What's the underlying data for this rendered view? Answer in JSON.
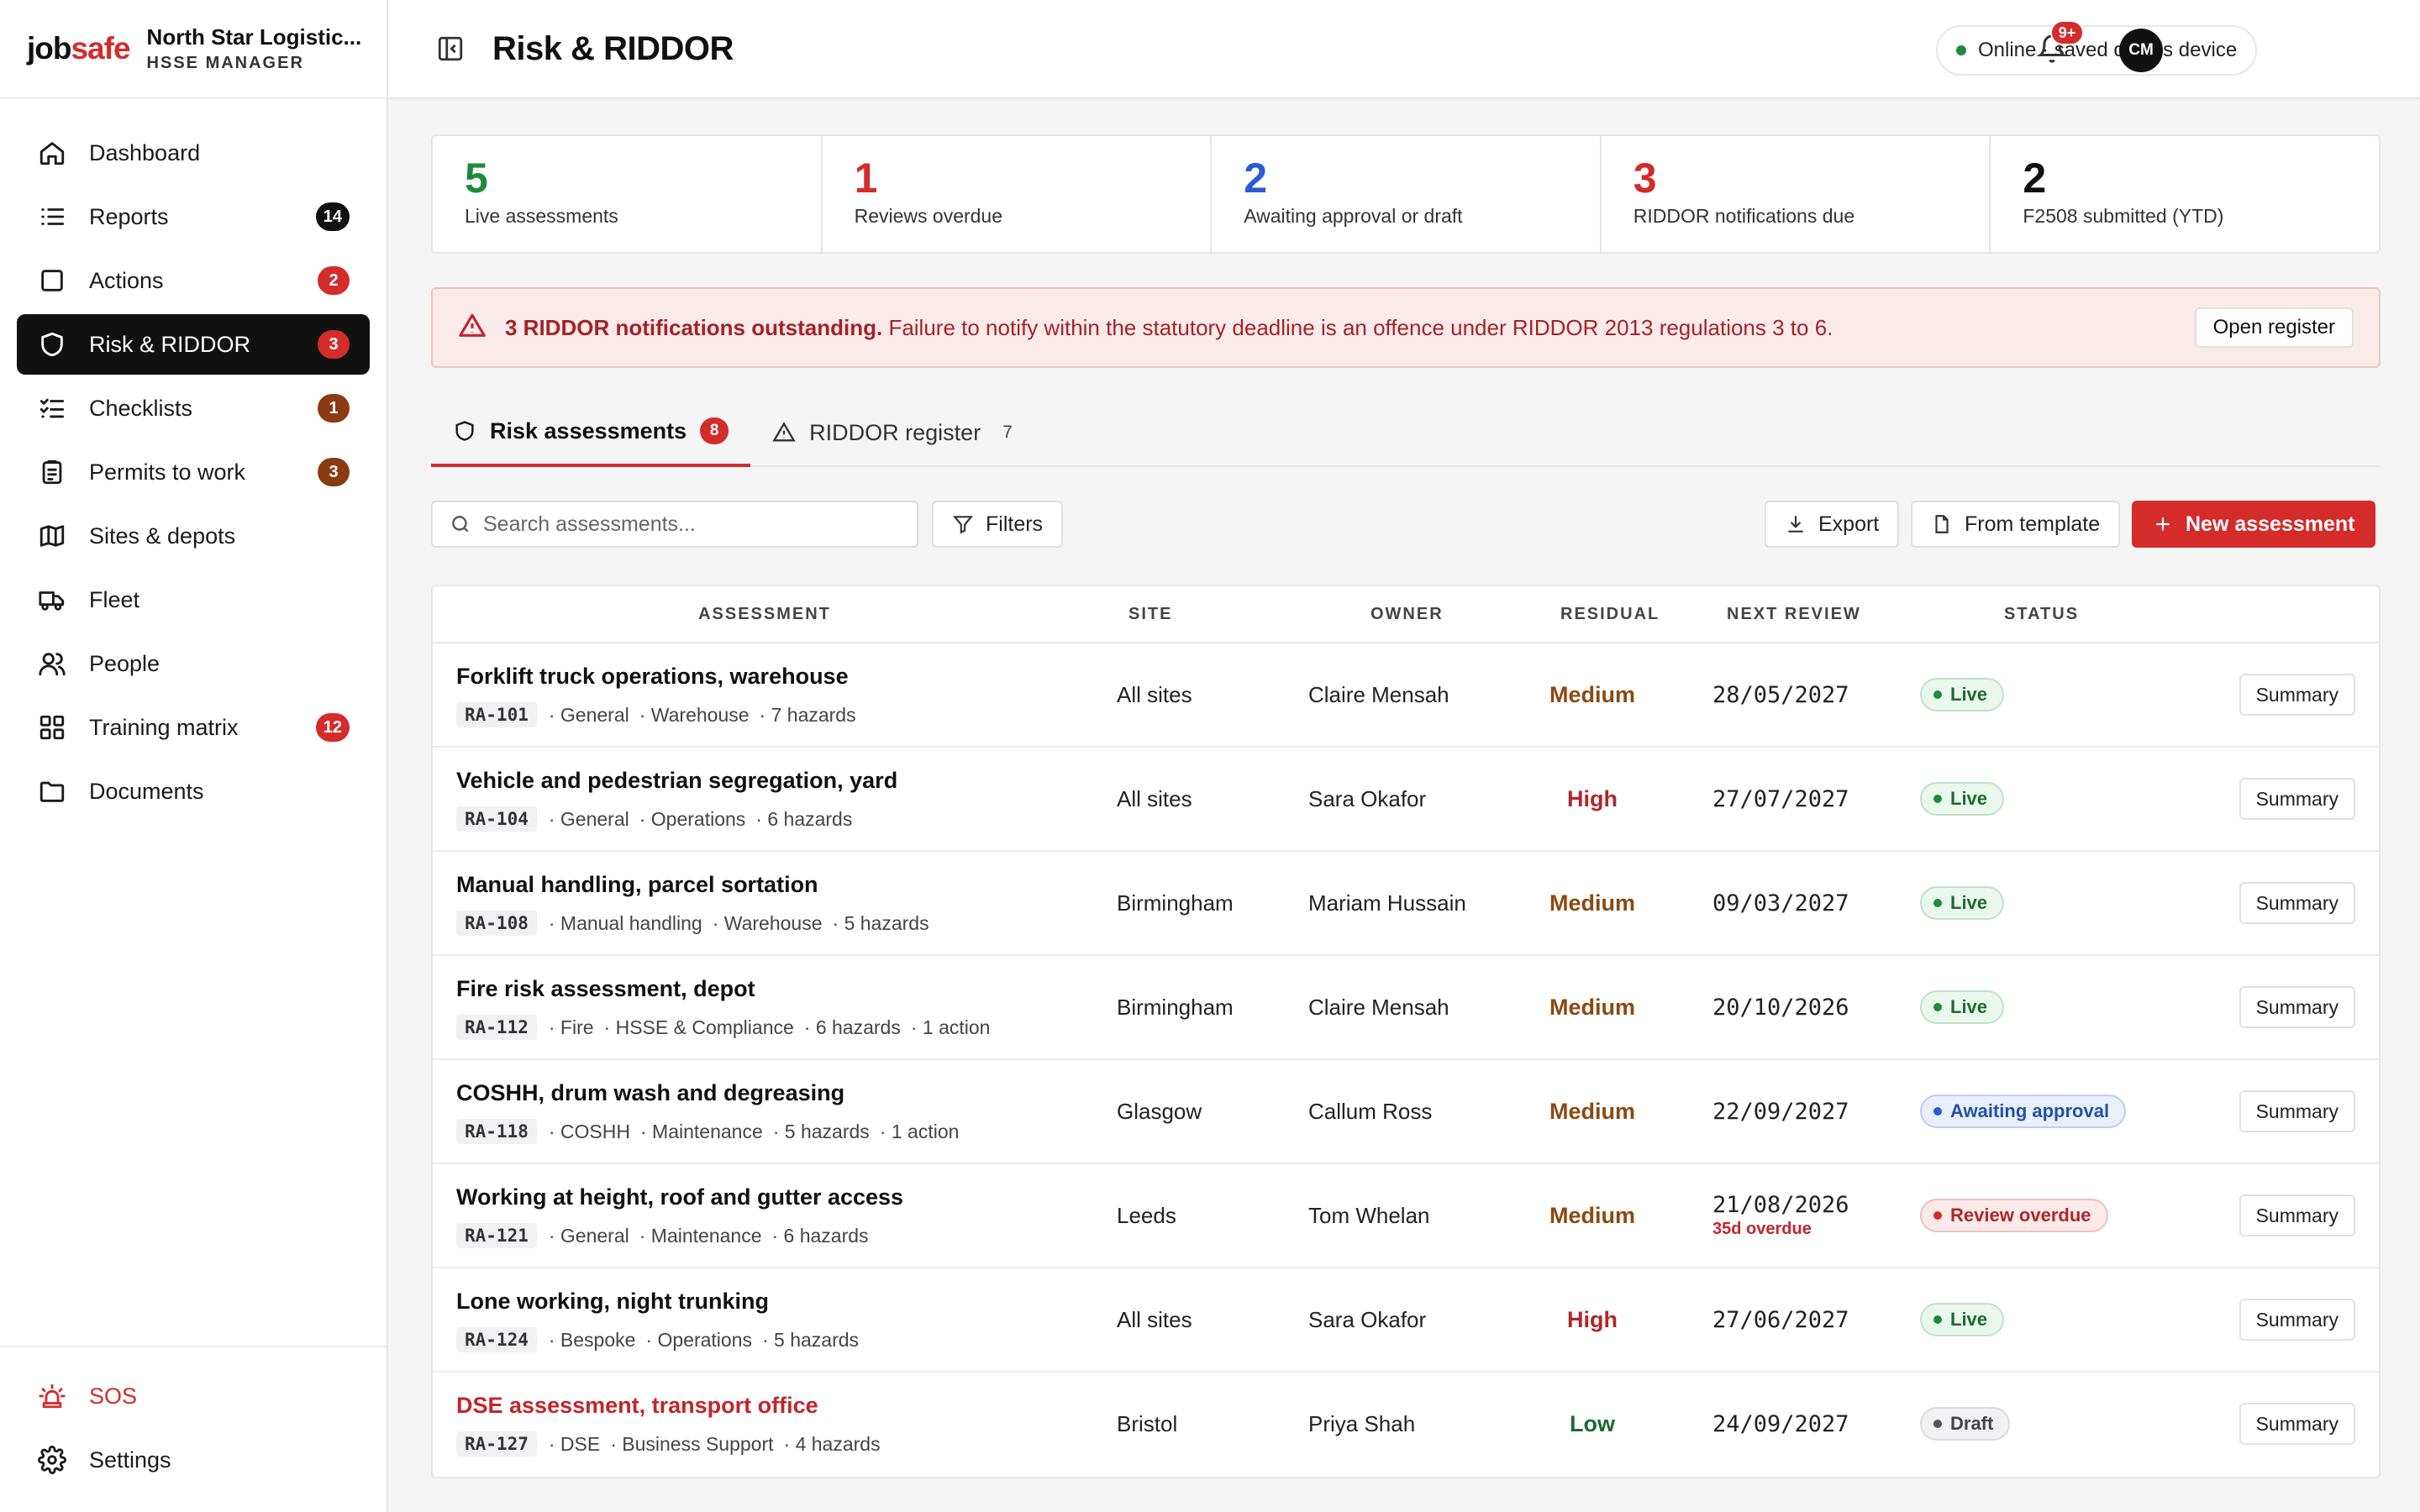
{
  "brand": {
    "logo_job": "job",
    "logo_safe": "safe",
    "org_name": "North Star Logistic...",
    "org_role": "HSSE MANAGER"
  },
  "nav": [
    {
      "label": "Dashboard",
      "icon": "home-icon"
    },
    {
      "label": "Reports",
      "icon": "list-icon",
      "badge": "14",
      "badge_color": "black"
    },
    {
      "label": "Actions",
      "icon": "checkbox-icon",
      "badge": "2",
      "badge_color": "red"
    },
    {
      "label": "Risk & RIDDOR",
      "icon": "shield-icon",
      "badge": "3",
      "badge_color": "red",
      "active": true
    },
    {
      "label": "Checklists",
      "icon": "checklist-icon",
      "badge": "1",
      "badge_color": "brown"
    },
    {
      "label": "Permits to work",
      "icon": "clipboard-icon",
      "badge": "3",
      "badge_color": "brown"
    },
    {
      "label": "Sites & depots",
      "icon": "map-icon"
    },
    {
      "label": "Fleet",
      "icon": "truck-icon"
    },
    {
      "label": "People",
      "icon": "people-icon"
    },
    {
      "label": "Training matrix",
      "icon": "grid-icon",
      "badge": "12",
      "badge_color": "red"
    },
    {
      "label": "Documents",
      "icon": "folder-icon"
    }
  ],
  "nav_bottom": {
    "sos": "SOS",
    "settings": "Settings"
  },
  "header": {
    "title": "Risk & RIDDOR",
    "status": "Online · saved on this device",
    "notif_badge": "9+",
    "avatar": "CM"
  },
  "stats": [
    {
      "value": "5",
      "label": "Live assessments",
      "color": "#1f8a3b"
    },
    {
      "value": "1",
      "label": "Reviews overdue",
      "color": "#d42b2b"
    },
    {
      "value": "2",
      "label": "Awaiting approval or draft",
      "color": "#2a5bd7"
    },
    {
      "value": "3",
      "label": "RIDDOR notifications due",
      "color": "#d42b2b"
    },
    {
      "value": "2",
      "label": "F2508 submitted (YTD)",
      "color": "#111111"
    }
  ],
  "alert": {
    "bold": "3 RIDDOR notifications outstanding.",
    "text": " Failure to notify within the statutory deadline is an offence under RIDDOR 2013 regulations 3 to 6.",
    "button": "Open register"
  },
  "tabs": [
    {
      "label": "Risk assessments",
      "count": "8"
    },
    {
      "label": "RIDDOR register",
      "count": "7"
    }
  ],
  "toolbar": {
    "search_placeholder": "Search assessments...",
    "filters": "Filters",
    "export": "Export",
    "from_template": "From template",
    "new_assessment": "New assessment"
  },
  "table": {
    "headers": {
      "assessment": "ASSESSMENT",
      "site": "SITE",
      "owner": "OWNER",
      "residual": "RESIDUAL",
      "next_review": "NEXT REVIEW",
      "status": "STATUS"
    },
    "summary_label": "Summary",
    "rows": [
      {
        "title": "Forklift truck operations, warehouse",
        "id": "RA-101",
        "meta": [
          "· General",
          "· Warehouse",
          "· 7 hazards"
        ],
        "site": "All sites",
        "owner": "Claire Mensah",
        "residual": "Medium",
        "review": "28/05/2027",
        "status": "Live",
        "status_kind": "live"
      },
      {
        "title": "Vehicle and pedestrian segregation, yard",
        "id": "RA-104",
        "meta": [
          "· General",
          "· Operations",
          "· 6 hazards"
        ],
        "site": "All sites",
        "owner": "Sara Okafor",
        "residual": "High",
        "review": "27/07/2027",
        "status": "Live",
        "status_kind": "live"
      },
      {
        "title": "Manual handling, parcel sortation",
        "id": "RA-108",
        "meta": [
          "· Manual handling",
          "· Warehouse",
          "· 5 hazards"
        ],
        "site": "Birmingham",
        "owner": "Mariam Hussain",
        "residual": "Medium",
        "review": "09/03/2027",
        "status": "Live",
        "status_kind": "live"
      },
      {
        "title": "Fire risk assessment, depot",
        "id": "RA-112",
        "meta": [
          "· Fire",
          "· HSSE & Compliance",
          "· 6 hazards",
          "· 1 action"
        ],
        "site": "Birmingham",
        "owner": "Claire Mensah",
        "residual": "Medium",
        "review": "20/10/2026",
        "status": "Live",
        "status_kind": "live"
      },
      {
        "title": "COSHH, drum wash and degreasing",
        "id": "RA-118",
        "meta": [
          "· COSHH",
          "· Maintenance",
          "· 5 hazards",
          "· 1 action"
        ],
        "site": "Glasgow",
        "owner": "Callum Ross",
        "residual": "Medium",
        "review": "22/09/2027",
        "status": "Awaiting approval",
        "status_kind": "awaiting"
      },
      {
        "title": "Working at height, roof and gutter access",
        "id": "RA-121",
        "meta": [
          "· General",
          "· Maintenance",
          "· 6 hazards"
        ],
        "site": "Leeds",
        "owner": "Tom Whelan",
        "residual": "Medium",
        "review": "21/08/2026",
        "review_note": "35d overdue",
        "status": "Review overdue",
        "status_kind": "overdue"
      },
      {
        "title": "Lone working, night trunking",
        "id": "RA-124",
        "meta": [
          "· Bespoke",
          "· Operations",
          "· 5 hazards"
        ],
        "site": "All sites",
        "owner": "Sara Okafor",
        "residual": "High",
        "review": "27/06/2027",
        "status": "Live",
        "status_kind": "live"
      },
      {
        "title": "DSE assessment, transport office",
        "id": "RA-127",
        "meta": [
          "· DSE",
          "· Business Support",
          "· 4 hazards"
        ],
        "site": "Bristol",
        "owner": "Priya Shah",
        "residual": "Low",
        "review": "24/09/2027",
        "status": "Draft",
        "status_kind": "draft",
        "highlight": true
      }
    ]
  }
}
